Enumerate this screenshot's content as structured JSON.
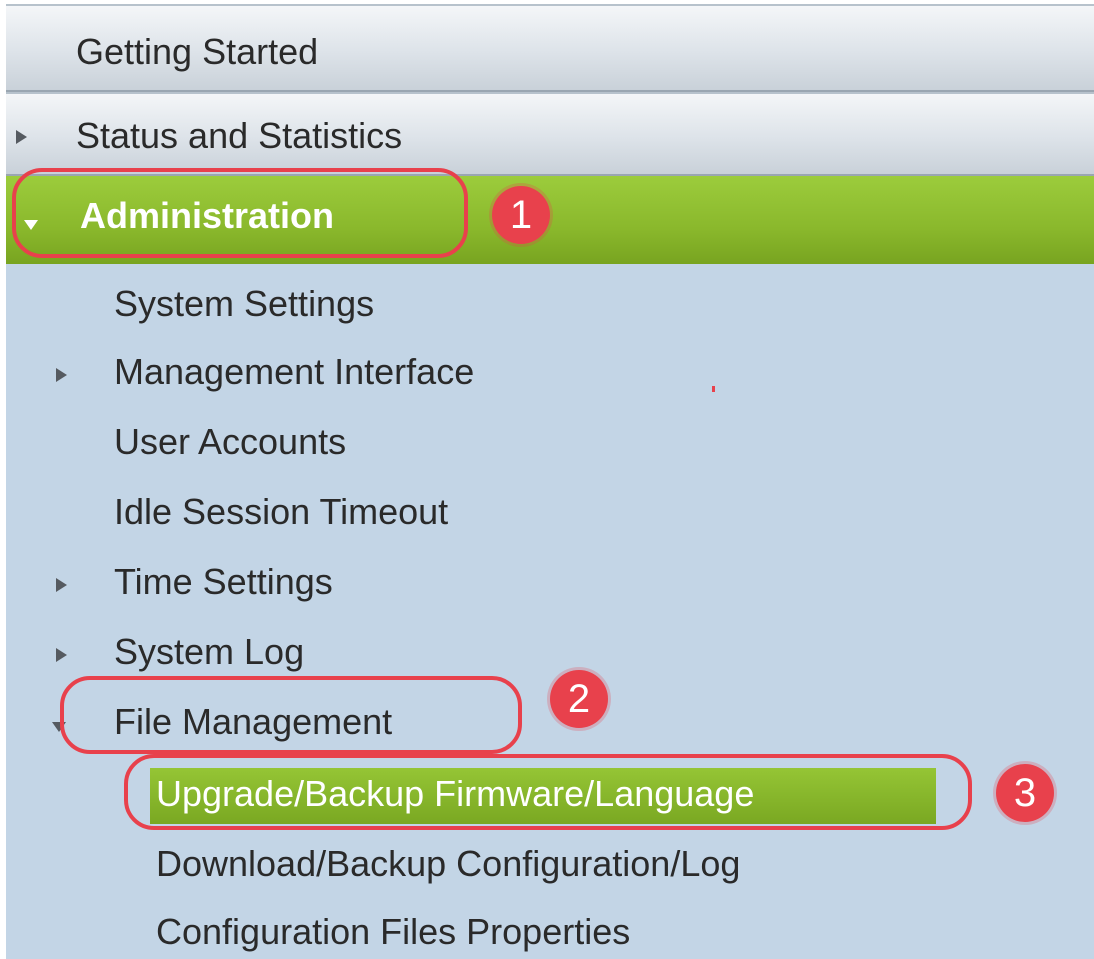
{
  "nav": {
    "getting_started": "Getting Started",
    "status_and_statistics": "Status and Statistics",
    "administration": {
      "label": "Administration",
      "items": [
        {
          "label": "System Settings"
        },
        {
          "label": "Management Interface"
        },
        {
          "label": "User Accounts"
        },
        {
          "label": "Idle Session Timeout"
        },
        {
          "label": "Time Settings"
        },
        {
          "label": "System Log"
        },
        {
          "label": "File Management",
          "items": [
            {
              "label": "Upgrade/Backup Firmware/Language",
              "selected": true
            },
            {
              "label": "Download/Backup Configuration/Log"
            },
            {
              "label": "Configuration Files Properties"
            }
          ]
        }
      ]
    }
  },
  "annotations": {
    "step1": "1",
    "step2": "2",
    "step3": "3"
  },
  "colors": {
    "nav_background": "#c3d5e6",
    "active_green": "#8ab82c",
    "annotation_red": "#e8414c"
  },
  "icons": {
    "collapsed": "triangle-right-icon",
    "expanded": "triangle-down-icon"
  }
}
